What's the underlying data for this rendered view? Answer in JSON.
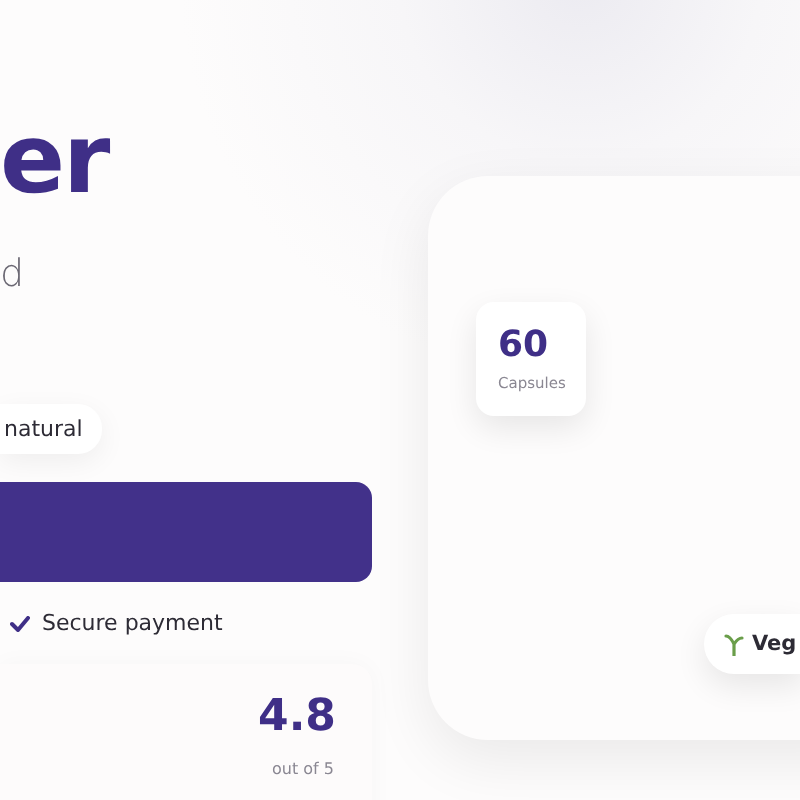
{
  "hero": {
    "heading": "er",
    "subtitle": "d",
    "badge": "natural",
    "cta": {
      "kind": "button"
    },
    "assurance": "Secure payment"
  },
  "rating": {
    "score": "4.8",
    "scale": "out of 5"
  },
  "product": {
    "count_chip": {
      "value": "60",
      "label": "Capsules"
    },
    "tag": "Veg"
  }
}
